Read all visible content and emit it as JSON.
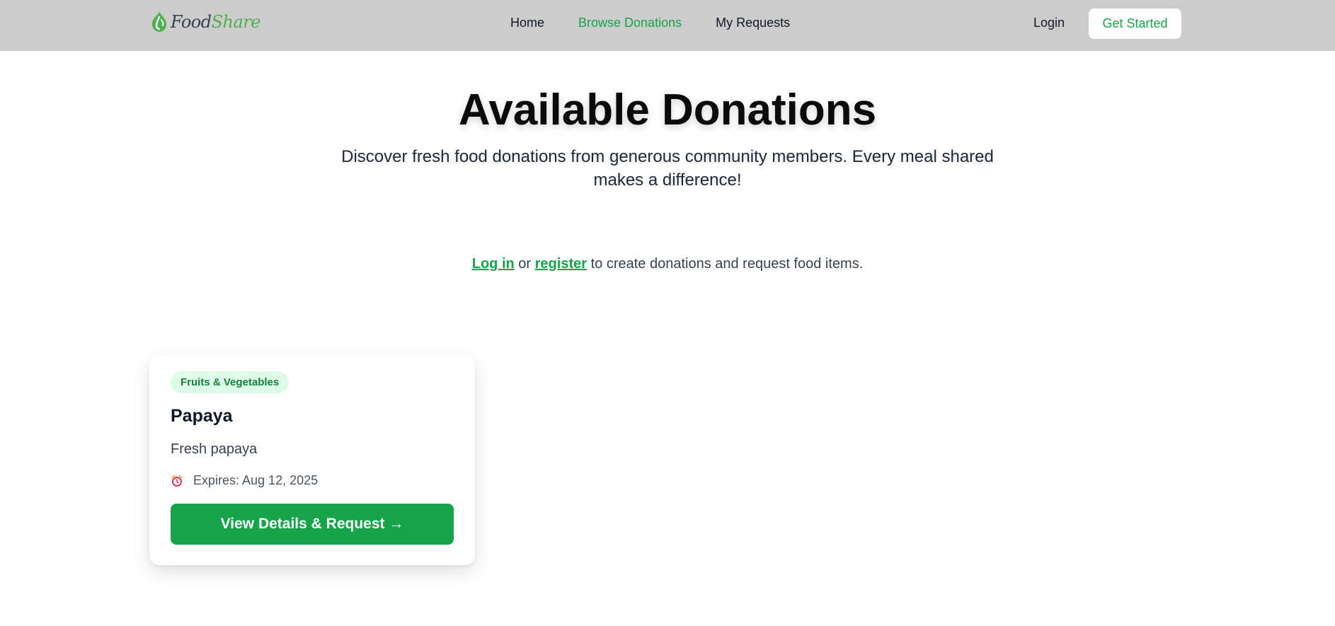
{
  "brand": {
    "name_part1": "Food",
    "name_part2": "Share",
    "accent_color": "#16a34a",
    "icon": "leaf-drop-logo-icon"
  },
  "nav": {
    "links": [
      {
        "label": "Home",
        "active": false
      },
      {
        "label": "Browse Donations",
        "active": true
      },
      {
        "label": "My Requests",
        "active": false
      }
    ],
    "login_label": "Login",
    "cta_label": "Get Started"
  },
  "hero": {
    "title": "Available Donations",
    "subtitle": "Discover fresh food donations from generous community members. Every meal shared makes a difference!"
  },
  "auth_note": {
    "login_link": "Log in",
    "or_text": "or",
    "register_link": "register",
    "suffix": "to create donations and request food items."
  },
  "donations": [
    {
      "category": "Fruits & Vegetables",
      "title": "Papaya",
      "description": "Fresh papaya",
      "expiry_icon": "alarm-clock-icon",
      "expiry_text": "Expires: Aug 12, 2025",
      "button_label": "View Details & Request →"
    }
  ]
}
